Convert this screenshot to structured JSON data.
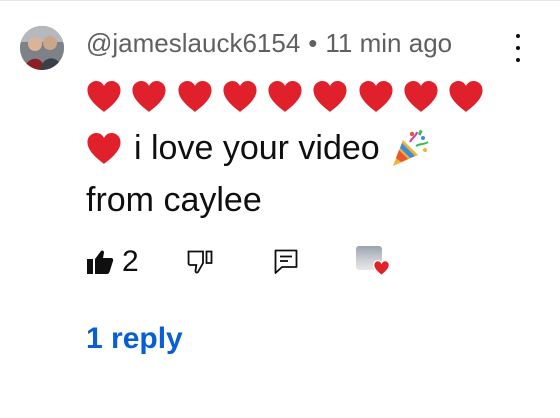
{
  "comment": {
    "author": "@jameslauck6154",
    "separator": "•",
    "timestamp": "11 min ago",
    "text_main": "i love your video",
    "text_tail": "from caylee",
    "emoji": {
      "heart": "red-heart",
      "party": "party-popper"
    },
    "heart_count_line1": 9,
    "likes": "2",
    "replies_label": "1 reply"
  },
  "colors": {
    "heart": "#e0212c",
    "link": "#065fd4",
    "meta": "#606060",
    "text": "#0f0f0f"
  },
  "icons": {
    "like": "thumbs-up-filled-icon",
    "dislike": "thumbs-down-outline-icon",
    "reply": "comment-icon",
    "more": "vertical-ellipsis-icon",
    "creator_heart": "creator-heart-badge"
  }
}
